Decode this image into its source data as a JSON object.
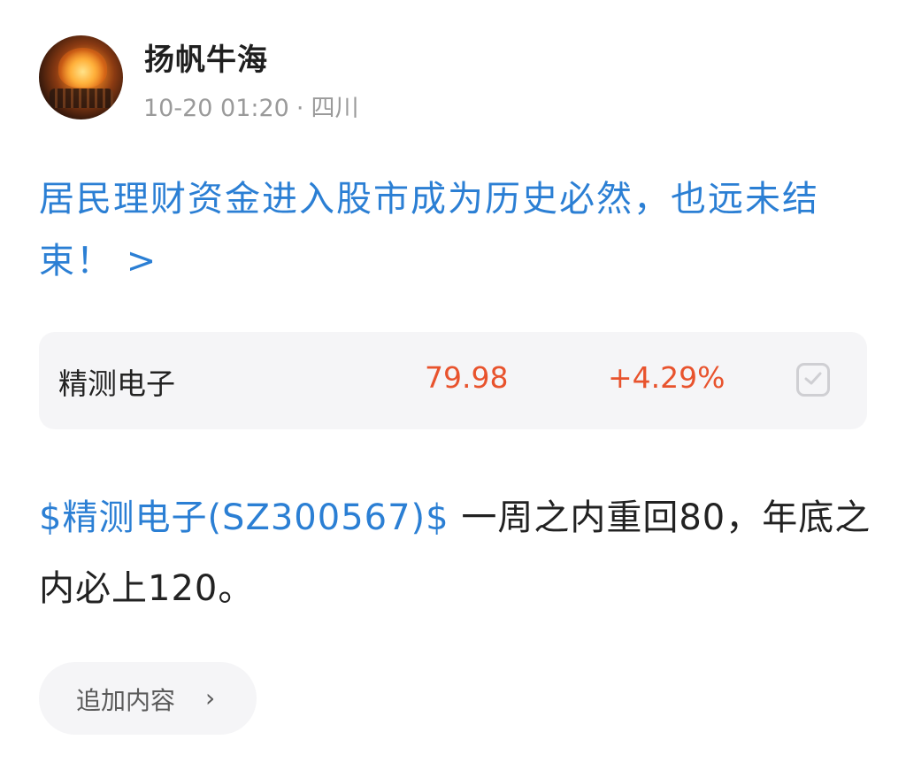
{
  "post": {
    "author": {
      "name": "扬帆牛海",
      "avatar_icon": "bbq-grill-avatar-icon"
    },
    "meta": {
      "time": "10-20 01:20",
      "separator": "·",
      "location": "四川"
    },
    "headline": "居民理财资金进入股市成为历史必然，也远未结束！ >",
    "stock_card": {
      "name": "精测电子",
      "price": "79.98",
      "change": "+4.29%",
      "check_icon": "checkbox-icon"
    },
    "body": {
      "cashtag": "$精测电子(SZ300567)$",
      "text": "一周之内重回80，年底之内必上120。"
    },
    "add_content_button": {
      "label": "追加内容",
      "chevron": "›"
    }
  },
  "colors": {
    "link_blue": "#2b7fd4",
    "stock_red": "#e8532d",
    "card_bg": "#f5f5f7",
    "meta_gray": "#9a9a9a"
  }
}
